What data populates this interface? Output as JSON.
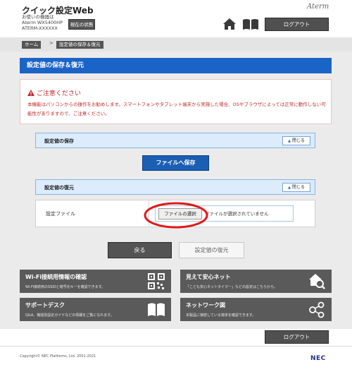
{
  "header": {
    "app_title": "クイック設定Web",
    "device_caption": "お使いの機器は",
    "model": "Aterm WX5400HP",
    "device_id": "ATERM-XXXXXX",
    "status_button": "現在の状態",
    "brand": "Aterm",
    "logout": "ログアウト",
    "icons": {
      "home": "home-icon",
      "manual": "book-icon"
    }
  },
  "breadcrumb": {
    "home": "ホーム",
    "separator": ">",
    "current": "設定値の保存＆復元"
  },
  "page": {
    "title": "設定値の保存＆復元"
  },
  "caution": {
    "title": "ご注意ください",
    "body": "本機能はパソコンからの操作をお勧めします。スマートフォンやタブレット端末から実施した場合、OSやブラウザによっては正常に動作しない可能性がありますので、ご注意ください。"
  },
  "save_section": {
    "title": "設定値の保存",
    "close_label": "閉じる",
    "save_button": "ファイルへ保存"
  },
  "restore_section": {
    "title": "設定値の復元",
    "close_label": "閉じる",
    "file_label": "設定ファイル",
    "choose_button": "ファイルの選択",
    "file_status": "ファイルが選択されていません"
  },
  "actions": {
    "back": "戻る",
    "restore": "設定値の復元"
  },
  "tiles": [
    {
      "title": "Wi-Fi接続用情報の確認",
      "desc": "Wi-Fi接続用のSSIDと暗号化キーを確認できます。",
      "icon": "qr-code-icon"
    },
    {
      "title": "見えて安心ネット",
      "desc": "「こども安心ネットタイマー」などの設定はこちらから。",
      "icon": "home-search-icon"
    },
    {
      "title": "サポートデスク",
      "desc": "Q&A、機能別設定ガイドなどの情報をご覧になれます。",
      "icon": "book-icon"
    },
    {
      "title": "ネットワーク図",
      "desc": "本製品に接続している端末を確認できます。",
      "icon": "network-icon"
    }
  ],
  "footer": {
    "logout": "ログアウト",
    "copyright": "Copyright© NEC Platforms, Ltd. 2001-2021",
    "nec": "NEC"
  },
  "colors": {
    "accent_blue": "#1b64c7",
    "caution_red": "#c12a2a",
    "dark_button": "#545454",
    "highlight_red": "#e01818"
  }
}
